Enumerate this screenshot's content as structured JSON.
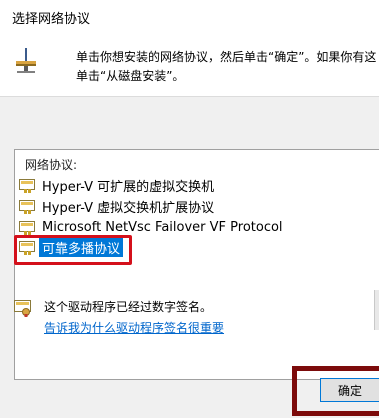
{
  "window": {
    "title": "选择网络协议"
  },
  "instruction": {
    "line1": "单击你想安装的网络协议，然后单击“确定”。如果你有这",
    "line2": "单击“从磁盘安装”。"
  },
  "protocol_list": {
    "header": "网络协议:",
    "items": [
      {
        "label": "Hyper-V 可扩展的虚拟交换机",
        "selected": false
      },
      {
        "label": "Hyper-V 虚拟交换机扩展协议",
        "selected": false
      },
      {
        "label": "Microsoft NetVsc Failover VF Protocol",
        "selected": false
      },
      {
        "label": "可靠多播协议",
        "selected": true
      }
    ]
  },
  "signature": {
    "status_text": "这个驱动程序已经过数字签名。",
    "link_text": "告诉我为什么驱动程序签名很重要"
  },
  "buttons": {
    "ok_label": "确定"
  },
  "colors": {
    "selection": "#0078d7",
    "highlight_red": "#d4101b",
    "highlight_dark_red": "#7c0b0b",
    "link": "#0066cc"
  }
}
